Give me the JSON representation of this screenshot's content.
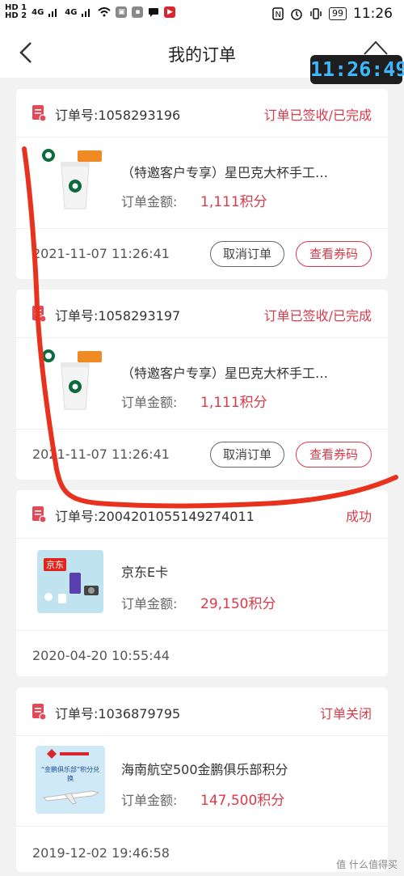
{
  "status_bar": {
    "sim1": "HD 1",
    "sim2": "HD 2",
    "net1": "4G",
    "net2": "4G",
    "battery": "99",
    "time": "11:26"
  },
  "header": {
    "title": "我的订单",
    "overlay_time": "11:26:49"
  },
  "orders": [
    {
      "order_no": "订单号:1058293196",
      "status": "订单已签收/已完成",
      "product_name": "（特邀客户专享）星巴克大杯手工…",
      "amount_label": "订单金额:",
      "amount": "1,111积分",
      "date": "2021-11-07 11:26:41",
      "buttons": [
        "取消订单",
        "查看券码"
      ]
    },
    {
      "order_no": "订单号:1058293197",
      "status": "订单已签收/已完成",
      "product_name": "（特邀客户专享）星巴克大杯手工…",
      "amount_label": "订单金额:",
      "amount": "1,111积分",
      "date": "2021-11-07 11:26:41",
      "buttons": [
        "取消订单",
        "查看券码"
      ]
    },
    {
      "order_no": "订单号:2004201055149274011",
      "status": "成功",
      "product_name": "京东E卡",
      "amount_label": "订单金额:",
      "amount": "29,150积分",
      "date": "2020-04-20 10:55:44",
      "thumb_text": "京东"
    },
    {
      "order_no": "订单号:1036879795",
      "status": "订单关闭",
      "product_name": "海南航空500金鹏俱乐部积分",
      "amount_label": "订单金额:",
      "amount": "147,500积分",
      "date": "2019-12-02 19:46:58",
      "thumb_text": "“金鹏俱乐部”积分兑换"
    }
  ],
  "watermark": "值 什么值得买",
  "colors": {
    "accent": "#d93a4a",
    "annotation": "#e8321e",
    "overlay_text": "#3db8ff"
  }
}
